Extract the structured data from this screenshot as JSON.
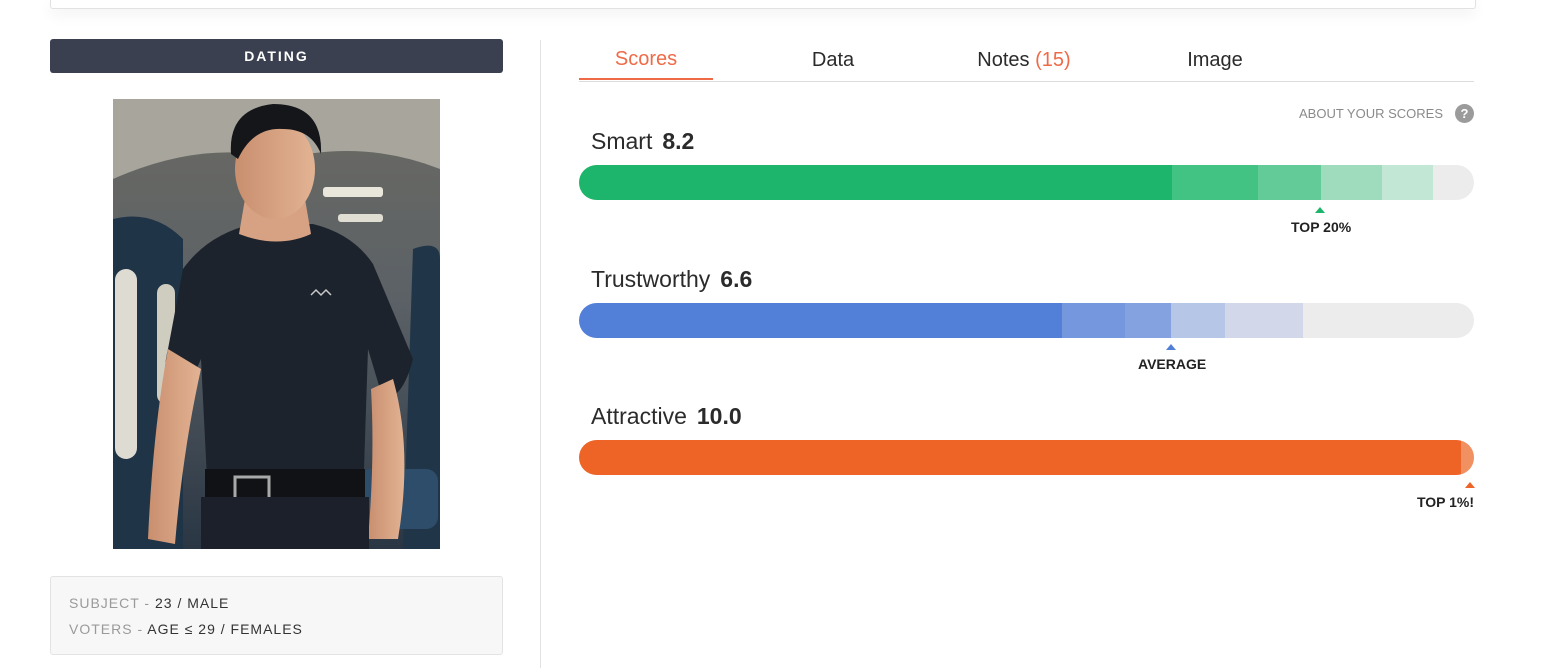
{
  "mode": "DATING",
  "tabs": [
    {
      "label": "Scores"
    },
    {
      "label": "Data"
    },
    {
      "label": "Notes",
      "count": "(15)"
    },
    {
      "label": "Image"
    }
  ],
  "about_scores": "ABOUT YOUR SCORES",
  "about_icon": "?",
  "traits": [
    {
      "name": "Smart",
      "score": "8.2",
      "marker": "TOP 20%",
      "color": "#1db56b",
      "segments": [
        "#1db56b",
        "#42c283",
        "#63cb98",
        "#9edcbd",
        "#c2e7d4"
      ]
    },
    {
      "name": "Trustworthy",
      "score": "6.6",
      "marker": "AVERAGE",
      "color": "#5280d8",
      "segments": [
        "#5280d8",
        "#7497dd",
        "#85a2e0",
        "#b6c6e7",
        "#d2d8ea"
      ]
    },
    {
      "name": "Attractive",
      "score": "10.0",
      "marker": "TOP 1%!",
      "color": "#ee6426",
      "segments": [
        "#ee6426",
        "#f19060"
      ]
    }
  ],
  "subject": {
    "label": "SUBJECT -",
    "value": "23 / MALE"
  },
  "voters": {
    "label": "VOTERS -",
    "value": "AGE ≤ 29 / FEMALES"
  },
  "photo": {
    "icon": "person-photo"
  }
}
